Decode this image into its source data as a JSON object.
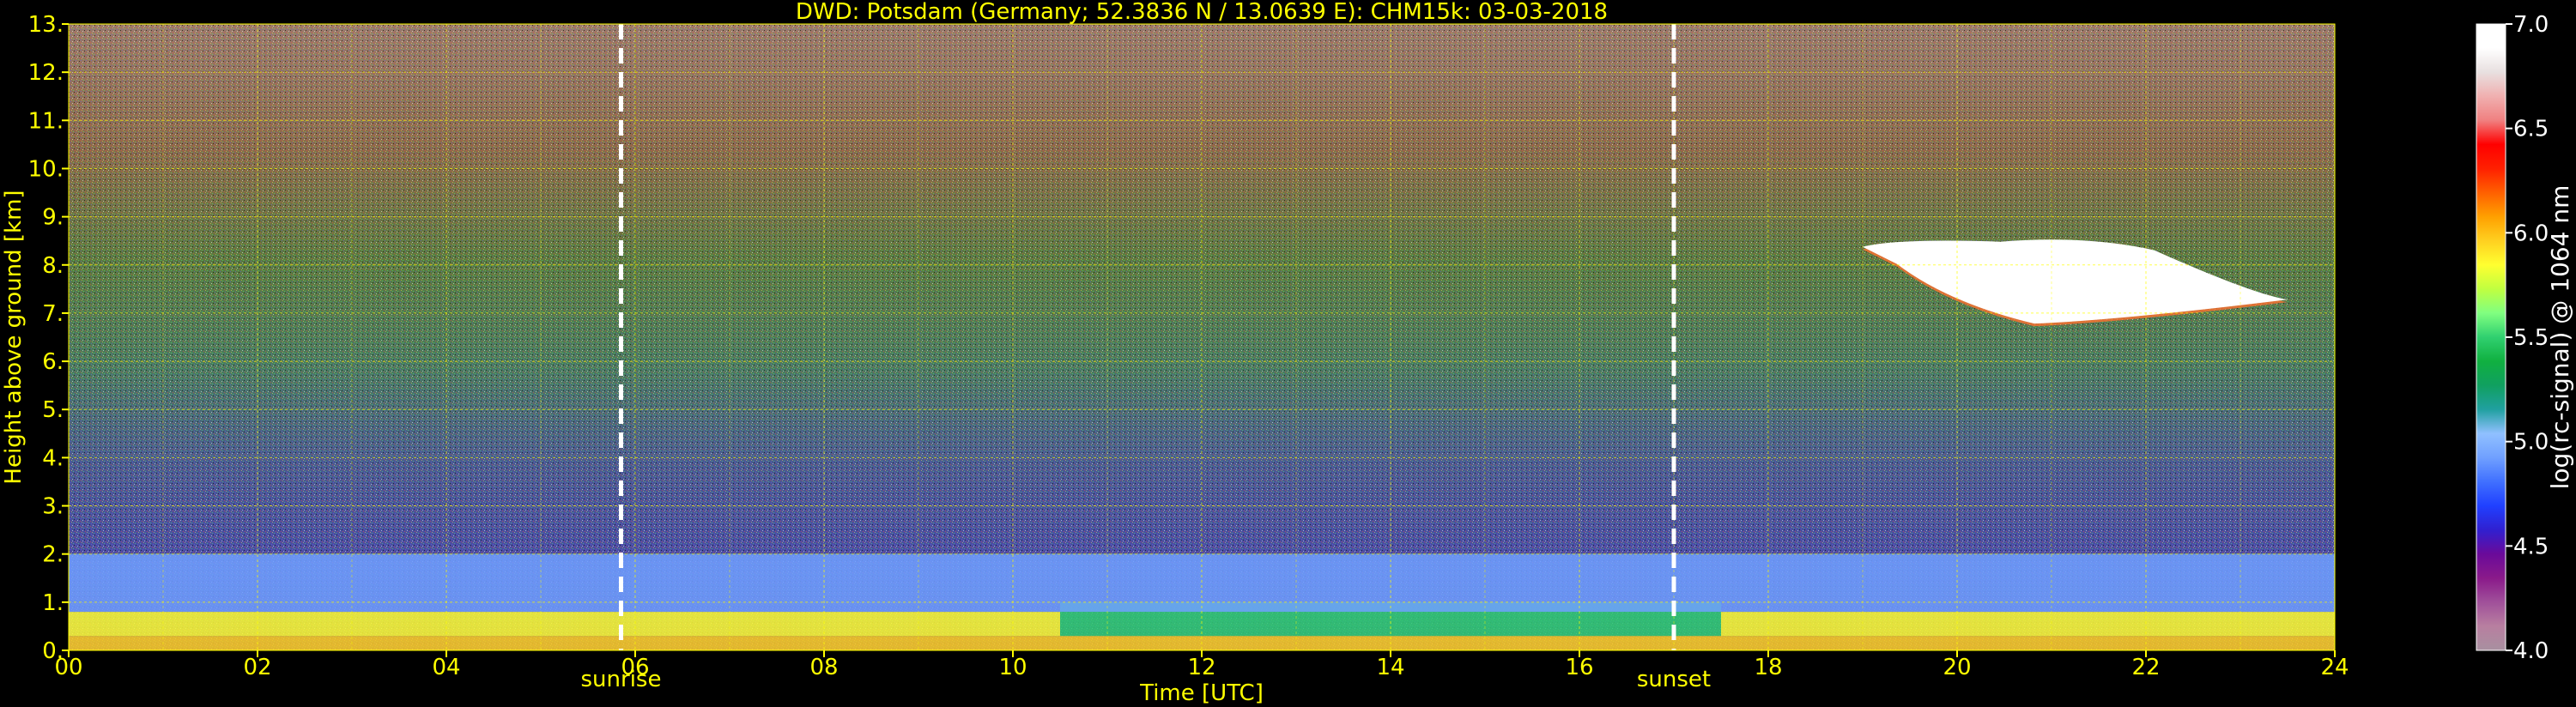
{
  "chart_data": {
    "type": "heatmap",
    "title": "DWD: Potsdam (Germany; 52.3836 N / 13.0639 E):    CHM15k: 03-03-2018",
    "xlabel": "Time [UTC]",
    "ylabel": "Height above ground [km]",
    "xlim": [
      0,
      24
    ],
    "ylim": [
      0,
      13
    ],
    "x_ticks": [
      0,
      2,
      4,
      6,
      8,
      10,
      12,
      14,
      16,
      18,
      20,
      22,
      24
    ],
    "x_tick_labels": [
      "00",
      "02",
      "04",
      "06",
      "08",
      "10",
      "12",
      "14",
      "16",
      "18",
      "20",
      "22",
      "24"
    ],
    "y_ticks": [
      0,
      1,
      2,
      3,
      4,
      5,
      6,
      7,
      8,
      9,
      10,
      11,
      12,
      13
    ],
    "y_tick_labels": [
      "0.",
      "1.",
      "2.",
      "3.",
      "4.",
      "5.",
      "6.",
      "7.",
      "8.",
      "9.",
      "10.",
      "11.",
      "12.",
      "13."
    ],
    "grid": true,
    "vertical_markers": [
      {
        "label": "sunrise",
        "time": 5.85
      },
      {
        "label": "sunset",
        "time": 17.0
      }
    ],
    "colorbar": {
      "label": "log(rc-signal) @ 1064 nm",
      "range": [
        4.0,
        7.0
      ],
      "ticks": [
        4.0,
        4.5,
        5.0,
        5.5,
        6.0,
        6.5,
        7.0
      ],
      "tick_labels": [
        "4.0",
        "4.5",
        "5.0",
        "5.5",
        "6.0",
        "6.5",
        "7.0"
      ],
      "colors": [
        "#a890a0",
        "#b87fa0",
        "#a0509a",
        "#8a1a8a",
        "#6a0a9a",
        "#3020d0",
        "#2040ff",
        "#4070ff",
        "#70a0ff",
        "#90c0ff",
        "#20a0a0",
        "#10a060",
        "#10b040",
        "#30d070",
        "#80ff80",
        "#c0ff40",
        "#ffff30",
        "#ffd020",
        "#ffa000",
        "#ff6000",
        "#ff2000",
        "#ff0000",
        "#f08080",
        "#f0b0b0",
        "#e8e0e0",
        "#ffffff",
        "#ffffff"
      ]
    },
    "layers": [
      {
        "feature": "surface aerosol layer",
        "height_km": [
          0.0,
          0.3
        ],
        "log_signal": 6.0
      },
      {
        "feature": "boundary layer (morning)",
        "time": [
          0,
          10.5
        ],
        "height_km": [
          0.3,
          0.8
        ],
        "log_signal": 5.8
      },
      {
        "feature": "boundary layer (midday)",
        "time": [
          10.5,
          17.5
        ],
        "height_km": [
          0.3,
          1.0
        ],
        "log_signal": 5.5
      },
      {
        "feature": "boundary layer (evening)",
        "time": [
          17.5,
          24
        ],
        "height_km": [
          0.3,
          0.8
        ],
        "log_signal": 5.8
      },
      {
        "feature": "residual layer",
        "height_km": [
          0.8,
          2.0
        ],
        "log_signal": 4.9
      },
      {
        "feature": "noisy free troposphere",
        "height_km": [
          2.0,
          13.0
        ],
        "log_signal": 5.3
      },
      {
        "feature": "cirrus cloud",
        "time": [
          19.0,
          23.5
        ],
        "height_km": [
          6.8,
          8.5
        ],
        "log_signal": 7.0
      }
    ]
  }
}
